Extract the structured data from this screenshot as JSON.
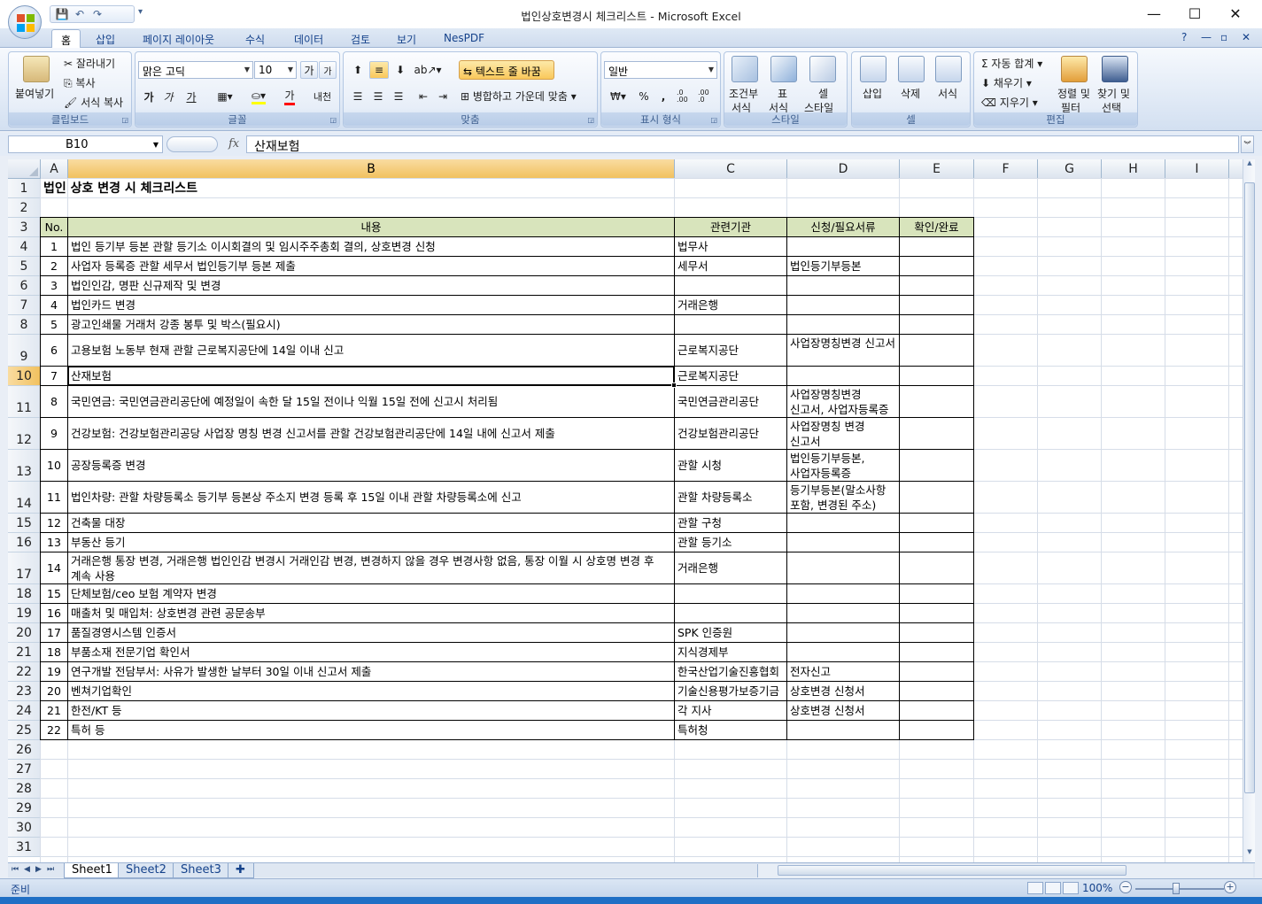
{
  "window": {
    "title": "법인상호변경시 체크리스트 - Microsoft Excel",
    "controls": {
      "minimize": "—",
      "maximize": "☐",
      "close": "✕"
    }
  },
  "quick_access": {
    "save": "💾",
    "undo": "↶",
    "redo": "↷",
    "more": "▾"
  },
  "ribbon_tabs": [
    "홈",
    "삽입",
    "페이지 레이아웃",
    "수식",
    "데이터",
    "검토",
    "보기",
    "NesPDF"
  ],
  "ribbon_right": {
    "help": "?",
    "min": "—",
    "restore": "▫",
    "close": "✕"
  },
  "ribbon": {
    "clipboard": {
      "paste": "붙여넣기",
      "cut": "잘라내기",
      "copy": "복사",
      "format_painter": "서식 복사",
      "label": "클립보드"
    },
    "font": {
      "name": "맑은 고딕",
      "size": "10",
      "grow": "가",
      "shrink": "가",
      "bold": "가",
      "italic": "가",
      "underline": "가",
      "color": "가",
      "phonetic": "내천",
      "label": "글꼴"
    },
    "alignment": {
      "wrap_text": "텍스트 줄 바꿈",
      "merge_center": "병합하고 가운데 맞춤",
      "label": "맞춤"
    },
    "number": {
      "format": "일반",
      "currency": "₩",
      "percent": "%",
      "comma": ",",
      "inc_dec": ".0 .00",
      "dec_dec": ".00 .0",
      "label": "표시 형식"
    },
    "styles": {
      "conditional": "조건부\n서식",
      "conditional_1": "조건부",
      "conditional_2": "서식",
      "table": "표",
      "table_2": "서식",
      "cell": "셀",
      "cell_2": "스타일",
      "label": "스타일"
    },
    "cells": {
      "insert": "삽입",
      "delete": "삭제",
      "format": "서식",
      "label": "셀"
    },
    "editing": {
      "autosum": "자동 합계",
      "fill": "채우기",
      "clear": "지우기",
      "sort_1": "정렬 및",
      "sort_2": "필터",
      "find_1": "찾기 및",
      "find_2": "선택",
      "label": "편집"
    }
  },
  "formula_bar": {
    "name_box": "B10",
    "fx": "fx",
    "content": "산재보험"
  },
  "columns": [
    "A",
    "B",
    "C",
    "D",
    "E",
    "F",
    "G",
    "H",
    "I"
  ],
  "selected_column": "B",
  "selected_row": "10",
  "sheet": {
    "title": "법인 상호 변경 시 체크리스트",
    "headers": {
      "no": "No.",
      "content": "내용",
      "agency": "관련기관",
      "docs": "신청/필요서류",
      "check": "확인/완료"
    },
    "rows": [
      {
        "row": "4",
        "no": "1",
        "content": "법인 등기부 등본 관할 등기소 이시회결의 및 임시주주총회 결의, 상호변경 신청",
        "agency": "법무사",
        "docs": ""
      },
      {
        "row": "5",
        "no": "2",
        "content": "사업자 등록증 관할 세무서 법인등기부 등본 제출",
        "agency": "세무서",
        "docs": "법인등기부등본"
      },
      {
        "row": "6",
        "no": "3",
        "content": "법인인감, 명판 신규제작 및 변경",
        "agency": "",
        "docs": ""
      },
      {
        "row": "7",
        "no": "4",
        "content": "법인카드 변경",
        "agency": "거래은행",
        "docs": ""
      },
      {
        "row": "8",
        "no": "5",
        "content": "광고인쇄물 거래처 강종 봉투 및 박스(필요시)",
        "agency": "",
        "docs": ""
      },
      {
        "row": "9",
        "no": "6",
        "content": "고용보험 노동부 현재 관할 근로복지공단에 14일 이내 신고",
        "agency": "근로복지공단",
        "docs": "사업장명칭변경 신고서"
      },
      {
        "row": "10",
        "no": "7",
        "content": "산재보험",
        "agency": "근로복지공단",
        "docs": ""
      },
      {
        "row": "11",
        "no": "8",
        "content": "국민연금: 국민연금관리공단에 예정일이 속한 달 15일 전이나 익월 15일 전에 신고시 처리됨",
        "agency": "국민연금관리공단",
        "docs": "사업장명칭변경 신고서, 사업자등록증"
      },
      {
        "row": "12",
        "no": "9",
        "content": "건강보험: 건강보험관리공당 사업장 명칭 변경 신고서를 관할 건강보험관리공단에 14일 내에 신고서 제출",
        "agency": "건강보험관리공단",
        "docs": "사업장명칭 변경 신고서"
      },
      {
        "row": "13",
        "no": "10",
        "content": "공장등록증 변경",
        "agency": "관할 시청",
        "docs": "법인등기부등본, 사업자등록증"
      },
      {
        "row": "14",
        "no": "11",
        "content": "법인차량: 관할 차량등록소 등기부 등본상 주소지 변경 등록 후 15일 이내 관할 차량등록소에 신고",
        "agency": "관할 차량등록소",
        "docs": "등기부등본(말소사항 포함, 변경된 주소)"
      },
      {
        "row": "15",
        "no": "12",
        "content": "건축물 대장",
        "agency": "관할 구청",
        "docs": ""
      },
      {
        "row": "16",
        "no": "13",
        "content": "부동산 등기",
        "agency": "관할 등기소",
        "docs": ""
      },
      {
        "row": "17",
        "no": "14",
        "content": "거래은행 통장 변경, 거래은행 법인인감 변경시 거래인감 변경, 변경하지 않을 경우 변경사항 없음, 통장 이월 시 상호명 변경 후 계속 사용",
        "agency": "거래은행",
        "docs": ""
      },
      {
        "row": "18",
        "no": "15",
        "content": "단체보험/ceo 보험 계약자 변경",
        "agency": "",
        "docs": ""
      },
      {
        "row": "19",
        "no": "16",
        "content": "매출처 및 매입처: 상호변경 관련 공문송부",
        "agency": "",
        "docs": ""
      },
      {
        "row": "20",
        "no": "17",
        "content": "품질경영시스템 인증서",
        "agency": "SPK 인증원",
        "docs": ""
      },
      {
        "row": "21",
        "no": "18",
        "content": "부품소재 전문기업 확인서",
        "agency": "지식경제부",
        "docs": ""
      },
      {
        "row": "22",
        "no": "19",
        "content": "연구개발 전담부서: 사유가 발생한 날부터 30일 이내 신고서 제출",
        "agency": "한국산업기술진흥협회",
        "docs": "전자신고"
      },
      {
        "row": "23",
        "no": "20",
        "content": "벤쳐기업확인",
        "agency": "기술신용평가보증기금",
        "docs": "상호변경 신청서"
      },
      {
        "row": "24",
        "no": "21",
        "content": "한전/KT 등",
        "agency": "각 지사",
        "docs": "상호변경 신청서"
      },
      {
        "row": "25",
        "no": "22",
        "content": "특허 등",
        "agency": "특허청",
        "docs": ""
      }
    ]
  },
  "row_numbers": [
    "1",
    "2",
    "3",
    "4",
    "5",
    "6",
    "7",
    "8",
    "9",
    "10",
    "11",
    "12",
    "13",
    "14",
    "15",
    "16",
    "17",
    "18",
    "19",
    "20",
    "21",
    "22",
    "23",
    "24",
    "25",
    "26",
    "27",
    "28",
    "29",
    "30",
    "31"
  ],
  "sheet_tabs": [
    "Sheet1",
    "Sheet2",
    "Sheet3"
  ],
  "sheet_nav": [
    "⏮",
    "◀",
    "▶",
    "⏭"
  ],
  "status": {
    "ready": "준비",
    "zoom": "100%",
    "zoom_out": "−",
    "zoom_in": "+"
  },
  "colors": {
    "header_fill": "#d8e4bc",
    "selection_header": "#f1c15f",
    "ribbon_bg": "#dfe9f5"
  }
}
